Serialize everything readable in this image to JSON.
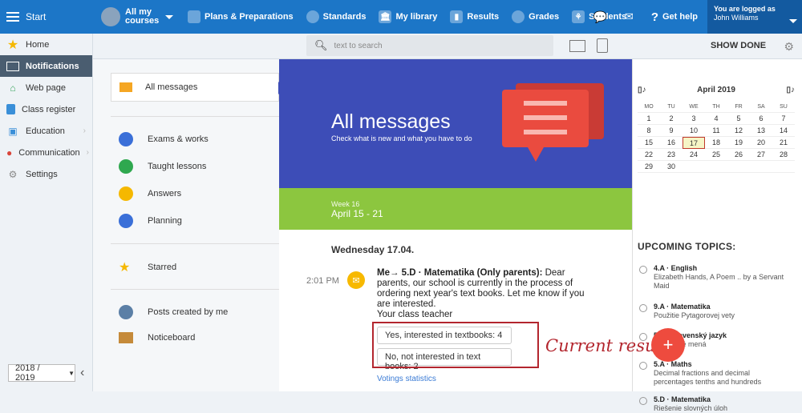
{
  "topbar": {
    "start": "Start",
    "mycourses": "All my courses",
    "nav": [
      "Plans & Preparations",
      "Standards",
      "My library",
      "Results",
      "Grades",
      "Students"
    ],
    "help": "Get help",
    "logged_label": "You are logged as",
    "user": "John Williams"
  },
  "sidebar": {
    "items": [
      "Home",
      "Notifications",
      "Web page",
      "Class register",
      "Education",
      "Communication",
      "Settings"
    ],
    "year": "2018 / 2019"
  },
  "search": {
    "placeholder": "text to search"
  },
  "showdone": "SHOW DONE",
  "menu": {
    "all": "All messages",
    "items": [
      "Exams & works",
      "Taught lessons",
      "Answers",
      "Planning"
    ],
    "starred": "Starred",
    "posts": "Posts created by me",
    "notice": "Noticeboard"
  },
  "banner": {
    "title": "All messages",
    "sub": "Check what is new and what you have to do"
  },
  "week": {
    "label": "Week 16",
    "range": "April 15 - 21"
  },
  "feed": {
    "day": "Wednesday 17.04.",
    "time": "2:01 PM",
    "head": "Me→ 5.D · Matematika (Only parents):",
    "body": " Dear parents, our school is currently in the process of ordering next year's text books. Let me know if you are interested.",
    "sign": "Your class teacher",
    "vote_yes": "Yes, interested in textbooks: 4",
    "vote_no": "No, not interested in text books: 2",
    "stats": "Votings statistics"
  },
  "annotation": "Current results",
  "calendar": {
    "month": "April 2019",
    "days": [
      "MO",
      "TU",
      "WE",
      "TH",
      "FR",
      "SA",
      "SU"
    ],
    "dates": [
      "1",
      "2",
      "3",
      "4",
      "5",
      "6",
      "7",
      "8",
      "9",
      "10",
      "11",
      "12",
      "13",
      "14",
      "15",
      "16",
      "17",
      "18",
      "19",
      "20",
      "21",
      "22",
      "23",
      "24",
      "25",
      "26",
      "27",
      "28",
      "29",
      "30",
      "",
      "",
      "",
      "",
      ""
    ]
  },
  "upcoming": {
    "title": "UPCOMING TOPICS:",
    "topics": [
      {
        "t": "4.A · English",
        "d": "Elizabeth Hands, A Poem .. by a Servant Maid"
      },
      {
        "t": "9.A · Matematika",
        "d": "Použitie Pytagorovej vety"
      },
      {
        "t": "5.D · Slovenský jazyk",
        "d": "Podstatné mená"
      },
      {
        "t": "5.A · Maths",
        "d": "Decimal fractions and decimal percentages tenths and hundreds"
      },
      {
        "t": "5.D · Matematika",
        "d": "Riešenie slovných úloh"
      }
    ]
  }
}
